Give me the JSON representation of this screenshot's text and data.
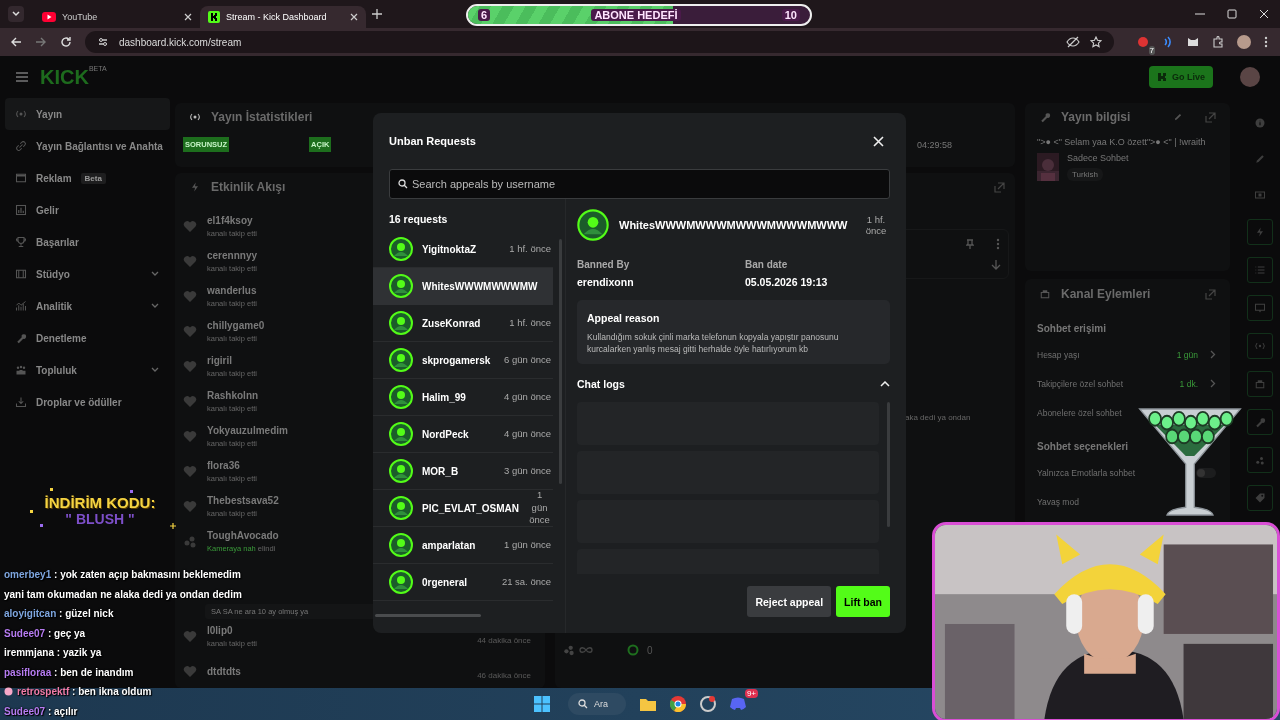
{
  "browser": {
    "tabs": [
      {
        "title": "YouTube",
        "selected": false
      },
      {
        "title": "Stream - Kick Dashboard",
        "selected": true
      }
    ],
    "url": "dashboard.kick.com/stream",
    "extension_badge": "7"
  },
  "subscriber_goal": {
    "current": "6",
    "label": "ABONE HEDEFİ",
    "target": "10",
    "level": 0.6
  },
  "header": {
    "logo": "KICK",
    "logo_tag": "BETA",
    "go_live": "Go Live"
  },
  "sidebar": [
    {
      "label": "Yayın",
      "selected": true
    },
    {
      "label": "Yayın Bağlantısı ve Anahta",
      "selected": false
    },
    {
      "label": "Reklam",
      "badge": "Beta",
      "selected": false
    },
    {
      "label": "Gelir",
      "selected": false
    },
    {
      "label": "Başarılar",
      "selected": false
    },
    {
      "label": "Stüdyo",
      "expanded": false,
      "selected": false
    },
    {
      "label": "Analitik",
      "expanded": false,
      "selected": false
    },
    {
      "label": "Denetleme",
      "selected": false
    },
    {
      "label": "Topluluk",
      "expanded": false,
      "selected": false
    },
    {
      "label": "Droplar ve ödüller",
      "selected": false
    }
  ],
  "stats": {
    "title": "Yayın İstatistikleri",
    "badges": [
      "SORUNSUZ",
      "AÇIK"
    ],
    "uptime": "04:29:58"
  },
  "activity": {
    "title": "Etkinlik Akışı",
    "events": [
      {
        "kind": "follow",
        "user": "el1f4ksoy",
        "action": "kanalı takip etti"
      },
      {
        "kind": "follow",
        "user": "cerennnyy",
        "action": "kanalı takip etti"
      },
      {
        "kind": "follow",
        "user": "wanderlus",
        "action": "kanalı takip etti"
      },
      {
        "kind": "follow",
        "user": "chillygame0",
        "action": "kanalı takip etti"
      },
      {
        "kind": "follow",
        "user": "rigiril",
        "action": "kanalı takip etti"
      },
      {
        "kind": "follow",
        "user": "Rashkolnn",
        "action": "kanalı takip etti"
      },
      {
        "kind": "follow",
        "user": "Yokyauzulmedim",
        "action": "kanalı takip etti"
      },
      {
        "kind": "follow",
        "user": "flora36",
        "action": "kanalı takip etti"
      },
      {
        "kind": "follow",
        "user": "Thebestsava52",
        "action": "kanalı takip etti"
      },
      {
        "kind": "reward",
        "user": "ToughAvocado",
        "highlight": "Kameraya nah",
        "action": "elindi"
      },
      {
        "kind": "resub",
        "message": "SA SA ne ara 10 ay olmuş ya"
      },
      {
        "kind": "follow",
        "user": "l0lip0",
        "action": "kanalı takip etti",
        "time": "44 dakika önce"
      },
      {
        "kind": "follow",
        "user": "dtdtdts",
        "time": "46 dakika önce"
      }
    ]
  },
  "chat_panel": {
    "message_fragment": "aka dedi ya ondan",
    "viewers": "0"
  },
  "stream_info": {
    "title": "Yayın bilgisi",
    "stream_title": "\">● <\" Selam yaa K.O özett\">● <\" | !wraith",
    "category": "Sadece Sohbet",
    "tag": "Turkish"
  },
  "channel_actions": {
    "title": "Kanal Eylemleri",
    "sections": [
      {
        "heading": "Sohbet erişimi",
        "rows": [
          {
            "kind": "value",
            "label": "Hesap yaşı",
            "value": "1 gün"
          },
          {
            "kind": "value",
            "label": "Takipçilere özel sohbet",
            "value": "1 dk."
          },
          {
            "kind": "plain",
            "label": "Abonelere özel sohbet"
          }
        ]
      },
      {
        "heading": "Sohbet seçenekleri",
        "rows": [
          {
            "kind": "toggle",
            "label": "Yalnızca Emotlarla sohbet",
            "on": false
          },
          {
            "kind": "plain",
            "label": "Yavaş mod"
          }
        ]
      }
    ]
  },
  "modal": {
    "title": "Unban Requests",
    "search_placeholder": "Search appeals by username",
    "count": "16 requests",
    "requests": [
      {
        "user": "YigitnoktaZ",
        "time": "1 hf. önce",
        "selected": false
      },
      {
        "user": "WhitesWWWMWWWMW",
        "selected": true
      },
      {
        "user": "ZuseKonrad",
        "time": "1 hf. önce",
        "selected": false
      },
      {
        "user": "skprogamersk",
        "time": "6 gün önce",
        "selected": false
      },
      {
        "user": "Halim_99",
        "time": "4 gün önce",
        "selected": false
      },
      {
        "user": "NordPeck",
        "time": "4 gün önce",
        "selected": false
      },
      {
        "user": "MOR_B",
        "time": "3 gün önce",
        "selected": false
      },
      {
        "user": "PIC_EVLAT_OSMAN",
        "time": "1 gün önce",
        "selected": false
      },
      {
        "user": "amparlatan",
        "time": "1 gün önce",
        "selected": false
      },
      {
        "user": "0rgeneral",
        "time": "21 sa. önce",
        "selected": false
      }
    ],
    "detail": {
      "user": "WhitesWWWMWWWMWWWMWWWMWWW",
      "time": "1 hf. önce",
      "banned_by_label": "Banned By",
      "banned_by": "erendixonn",
      "ban_date_label": "Ban date",
      "ban_date": "05.05.2026 19:13",
      "reason_title": "Appeal reason",
      "reason": "Kullandığım sokuk çinli marka telefonun kopyala yapıştır panosunu kurcalarken yanlış mesaj gitti herhalde öyle hatırlıyorum kb",
      "chat_logs_title": "Chat logs",
      "chat_logs_expanded": true
    },
    "actions": [
      "Reject appeal",
      "Lift ban"
    ]
  },
  "stream_overlay": {
    "discount_title": "İNDİRİM KODU:",
    "discount_code": "\" BLUSH \"",
    "chat": [
      {
        "user": "omerbey1",
        "color": "#7ea6e0",
        "badge": false,
        "message": ": yok zaten açıp bakmasını beklemedim yani tam okumadan ne alaka dedi ya ondan dedim"
      },
      {
        "user": "aloyigitcan",
        "color": "#7ea6e0",
        "badge": false,
        "message": ": güzel nick"
      },
      {
        "user": "Sudee07",
        "color": "#b77cf2",
        "badge": false,
        "message": ": geç ya"
      },
      {
        "user": "iremmjana",
        "color": "#ffffff",
        "badge": false,
        "message": ": yazik ya"
      },
      {
        "user": "pasifloraa",
        "color": "#b77cf2",
        "badge": false,
        "message": ": ben de inandım"
      },
      {
        "user": "retrospektf",
        "color": "#f27ca8",
        "badge": true,
        "message": ": ben ikna oldum"
      },
      {
        "user": "Sudee07",
        "color": "#b77cf2",
        "badge": false,
        "message": ": açılır"
      }
    ]
  },
  "taskbar": {
    "search": "Ara",
    "notification": "9+"
  }
}
